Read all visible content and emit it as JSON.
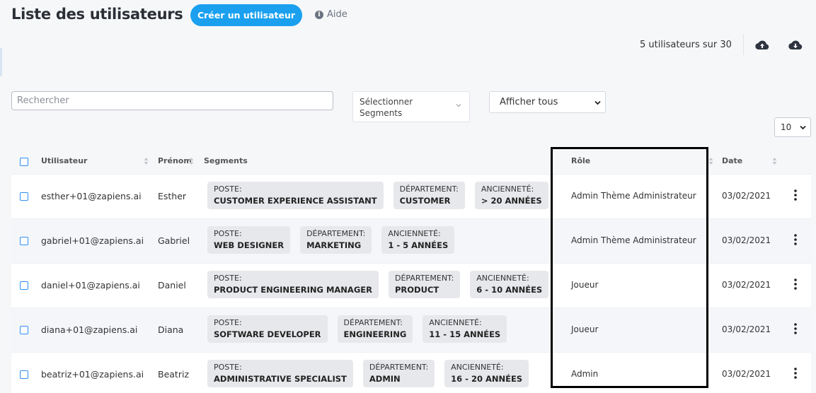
{
  "header": {
    "title": "Liste des utilisateurs",
    "create_button": "Créer un utilisateur",
    "help_icon_glyph": "i",
    "help_label": "Aide"
  },
  "summary": {
    "count_text": "5 utilisateurs sur 30",
    "upload_icon": "cloud-upload-icon",
    "download_icon": "cloud-download-icon"
  },
  "filters": {
    "search_placeholder": "Rechercher",
    "segments_placeholder": "Sélectionner Segments",
    "display_value": "Afficher tous",
    "page_size": "10"
  },
  "table": {
    "columns": {
      "user": "Utilisateur",
      "firstname": "Prénom",
      "segments": "Segments",
      "role": "Rôle",
      "date": "Date"
    },
    "rows": [
      {
        "email": "esther+01@zapiens.ai",
        "firstname": "Esther",
        "tags": [
          {
            "key": "POSTE:",
            "value": "CUSTOMER EXPERIENCE ASSISTANT"
          },
          {
            "key": "DÉPARTEMENT:",
            "value": "CUSTOMER"
          },
          {
            "key": "ANCIENNETÉ:",
            "value": "> 20 ANNÉES"
          }
        ],
        "role": "Admin Thème Administrateur",
        "date": "03/02/2021"
      },
      {
        "email": "gabriel+01@zapiens.ai",
        "firstname": "Gabriel",
        "tags": [
          {
            "key": "POSTE:",
            "value": "WEB DESIGNER"
          },
          {
            "key": "DÉPARTEMENT:",
            "value": "MARKETING"
          },
          {
            "key": "ANCIENNETÉ:",
            "value": "1 - 5 ANNÉES"
          }
        ],
        "role": "Admin Thème Administrateur",
        "date": "03/02/2021"
      },
      {
        "email": "daniel+01@zapiens.ai",
        "firstname": "Daniel",
        "tags": [
          {
            "key": "POSTE:",
            "value": "PRODUCT ENGINEERING MANAGER"
          },
          {
            "key": "DÉPARTEMENT:",
            "value": "PRODUCT"
          },
          {
            "key": "ANCIENNETÉ:",
            "value": "6 - 10 ANNÉES"
          }
        ],
        "role": "Joueur",
        "date": "03/02/2021"
      },
      {
        "email": "diana+01@zapiens.ai",
        "firstname": "Diana",
        "tags": [
          {
            "key": "POSTE:",
            "value": "SOFTWARE DEVELOPER"
          },
          {
            "key": "DÉPARTEMENT:",
            "value": "ENGINEERING"
          },
          {
            "key": "ANCIENNETÉ:",
            "value": "11 - 15 ANNÉES"
          }
        ],
        "role": "Joueur",
        "date": "03/02/2021"
      },
      {
        "email": "beatriz+01@zapiens.ai",
        "firstname": "Beatriz",
        "tags": [
          {
            "key": "POSTE:",
            "value": "ADMINISTRATIVE SPECIALIST"
          },
          {
            "key": "DÉPARTEMENT:",
            "value": "ADMIN"
          },
          {
            "key": "ANCIENNETÉ:",
            "value": "16 - 20 ANNÉES"
          }
        ],
        "role": "Admin",
        "date": "03/02/2021"
      }
    ]
  },
  "colors": {
    "accent": "#1aa0ef",
    "checkbox": "#2f8ff0",
    "tag_bg": "#e6e8eb",
    "highlight": "#000000"
  }
}
